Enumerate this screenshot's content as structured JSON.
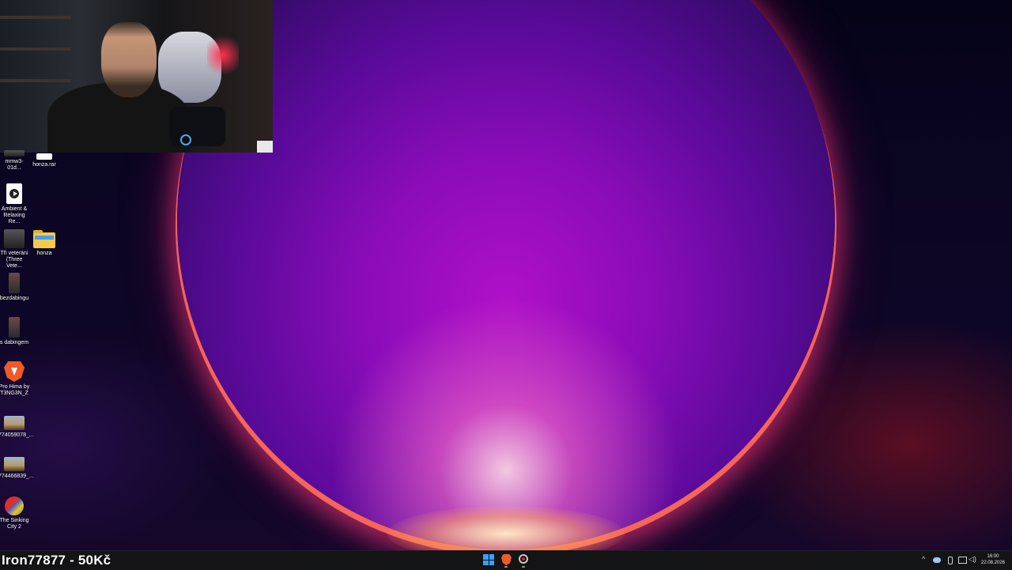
{
  "desktop": {
    "icons": [
      {
        "label": "mmw3-01d...",
        "type": "video"
      },
      {
        "label": "honza.rar",
        "type": "rar"
      },
      {
        "label": "Ambient & Relaxing Re...",
        "type": "media"
      },
      {
        "label": "Tři veteráni (Three Vete...",
        "type": "video"
      },
      {
        "label": "honza",
        "type": "folder"
      },
      {
        "label": "bezdabingu",
        "type": "phone"
      },
      {
        "label": "s dabingem",
        "type": "phone"
      },
      {
        "label": "Pro Hima by T3NG3N_Z",
        "type": "brave"
      },
      {
        "label": "774059078_...",
        "type": "photo"
      },
      {
        "label": "774466839_...",
        "type": "photo"
      },
      {
        "label": "The Sinking City 2",
        "type": "game"
      }
    ]
  },
  "stream_overlay": {
    "text": "Iron77877 - 50Kč"
  },
  "taskbar": {
    "apps": [
      "start-icon",
      "brave-browser-icon",
      "obs-studio-icon"
    ],
    "tray": [
      "chevron-up-icon",
      "cloud-icon",
      "microphone-icon",
      "network-icon",
      "speaker-icon"
    ],
    "clock": {
      "time": "16:00",
      "date": "22.08.2026"
    }
  },
  "colors": {
    "taskbar_bg": "#121416",
    "windows_blue": "#3aa0ff",
    "brave_orange": "#f05a28"
  }
}
